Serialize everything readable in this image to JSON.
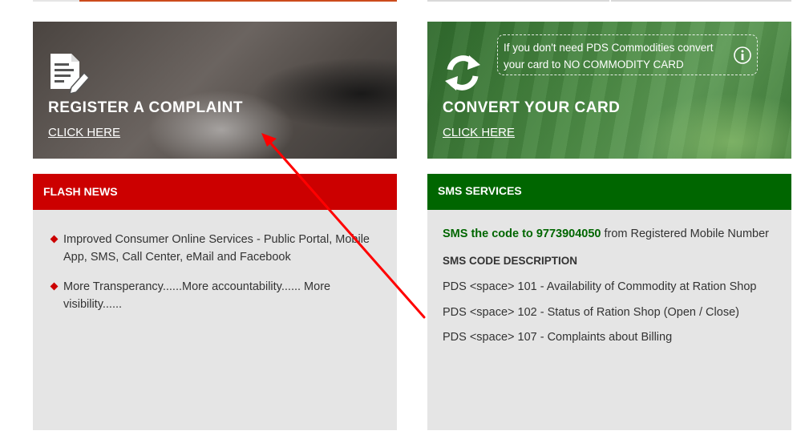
{
  "banners": {
    "complaint": {
      "title": "REGISTER A COMPLAINT",
      "link": "CLICK HERE",
      "icon": "document-edit-icon"
    },
    "convert": {
      "title": "CONVERT YOUR CARD",
      "link": "CLICK HERE",
      "icon": "refresh-icon",
      "note": "If you don't need PDS Commodities convert your card to NO COMMODITY CARD",
      "note_icon": "info-icon"
    }
  },
  "flash_news": {
    "header": "FLASH NEWS",
    "items": [
      "Improved Consumer Online Services - Public Portal, Mobile App, SMS, Call Center, eMail and Facebook",
      "More Transperancy......More accountability...... More visibility......"
    ]
  },
  "sms_services": {
    "header": "SMS SERVICES",
    "intro_highlight": "SMS the code to 9773904050",
    "intro_rest": " from Registered Mobile Number",
    "code_heading": "SMS CODE DESCRIPTION",
    "codes": [
      "PDS <space> 101 - Availability of Commodity at Ration Shop",
      "PDS <space> 102 - Status of Ration Shop (Open / Close)",
      "PDS <space> 107 - Complaints about Billing"
    ]
  },
  "colors": {
    "flash_header": "#cc0000",
    "sms_header": "#006600",
    "panel_bg": "#e5e5e5",
    "annotation": "#ff0000"
  }
}
